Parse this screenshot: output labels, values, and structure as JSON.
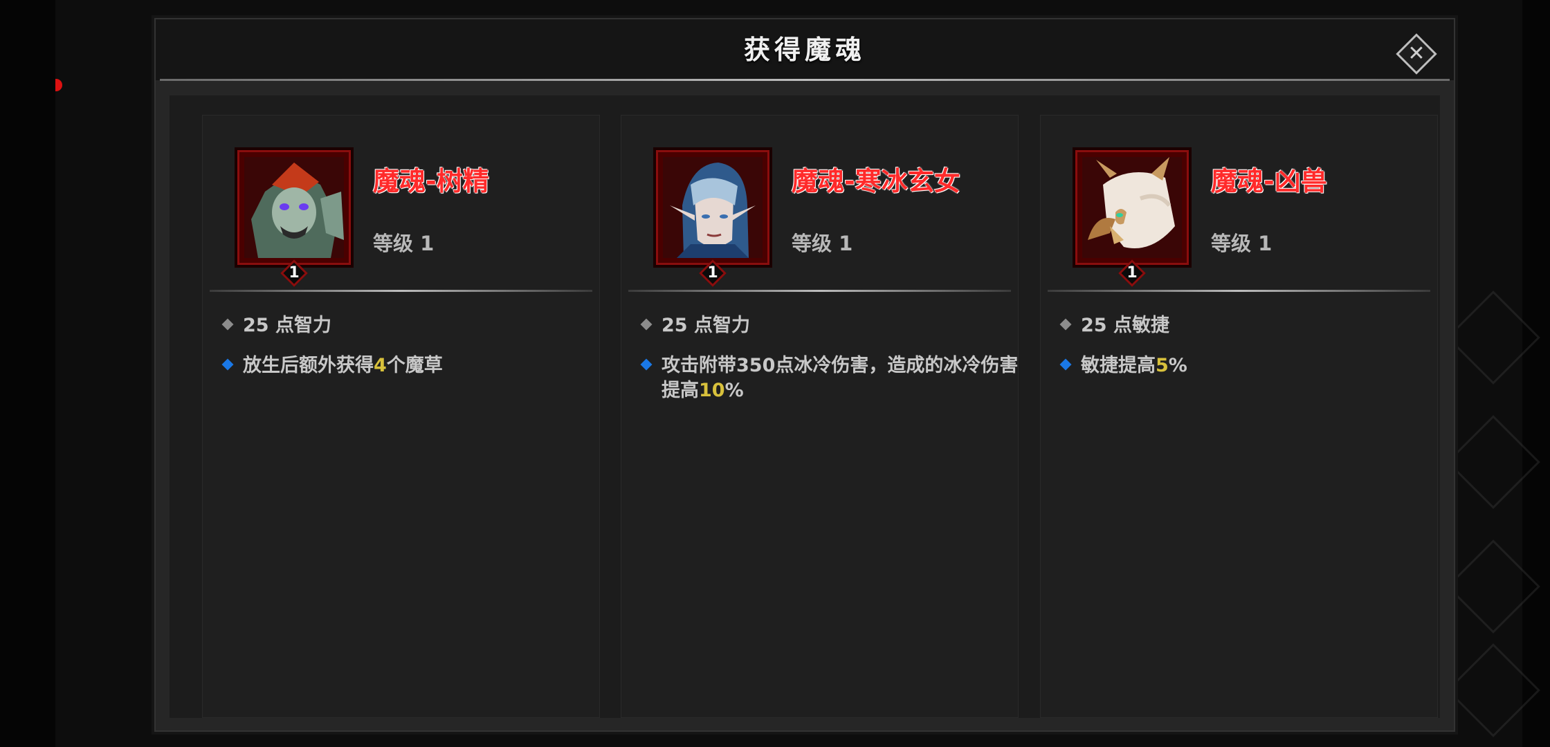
{
  "dialog": {
    "title": "获得魔魂",
    "close_icon": "close-icon"
  },
  "cards": [
    {
      "name": "魔魂-树精",
      "level_text": "等级 1",
      "badge": "1",
      "stat1": "25 点智力",
      "stat2_prefix": "放生后额外获得",
      "stat2_value": "4",
      "stat2_suffix": "个魔草"
    },
    {
      "name": "魔魂-寒冰玄女",
      "level_text": "等级 1",
      "badge": "1",
      "stat1": "25 点智力",
      "stat2_prefix": "攻击附带350点冰冷伤害，造成的冰冷伤害提高",
      "stat2_value": "10",
      "stat2_suffix": "%"
    },
    {
      "name": "魔魂-凶兽",
      "level_text": "等级 1",
      "badge": "1",
      "stat1": "25 点敏捷",
      "stat2_prefix": "敏捷提高",
      "stat2_value": "5",
      "stat2_suffix": "%"
    }
  ],
  "colors": {
    "name_red": "#ff2a2a",
    "highlight_yellow": "#d8c13c",
    "bullet_blue": "#1a78e6",
    "portrait_frame": "#8a0d0d"
  }
}
